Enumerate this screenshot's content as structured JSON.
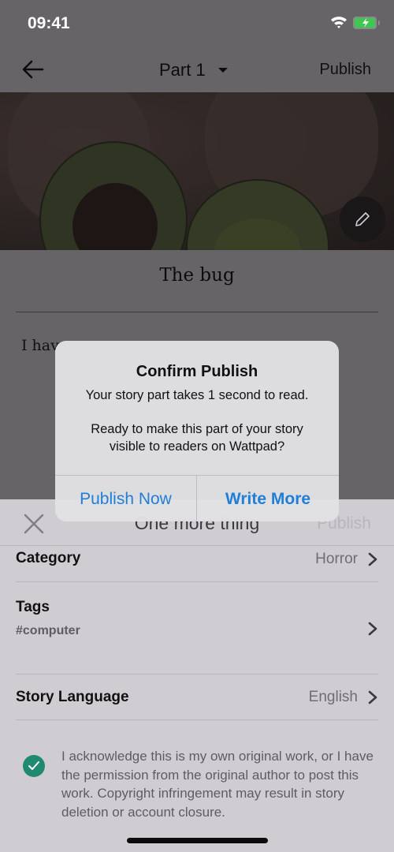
{
  "status_bar": {
    "time": "09:41"
  },
  "nav": {
    "part_title": "Part 1",
    "publish_label": "Publish"
  },
  "story": {
    "title": "The bug",
    "body_excerpt": "I hav"
  },
  "sheet": {
    "title": "One more thing",
    "publish_label": "Publish",
    "rows": [
      {
        "label": "Category",
        "value": "Horror"
      },
      {
        "label": "Tags",
        "value": "#computer"
      },
      {
        "label": "Story Language",
        "value": "English"
      }
    ],
    "acknowledgement": {
      "checked": true,
      "text": "I acknowledge this is my own original work, or I have the permission from the original author to post this work. Copyright infringement may result in story deletion or account closure."
    }
  },
  "alert": {
    "title": "Confirm Publish",
    "message_line1": "Your story part takes 1 second to read.",
    "message_line2": "Ready to make this part of your story visible to readers on Wattpad?",
    "publish_now_label": "Publish Now",
    "write_more_label": "Write More"
  },
  "colors": {
    "accent_blue": "#1f7fd8",
    "check_green": "#1f8a70",
    "battery_green": "#3ec850"
  }
}
